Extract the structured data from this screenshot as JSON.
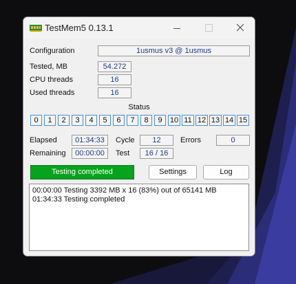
{
  "window": {
    "title": "TestMem5  0.13.1",
    "icons": {
      "app": "memory-module-icon",
      "minimize": "minimize-icon",
      "maximize": "maximize-icon",
      "close": "close-icon"
    }
  },
  "config": {
    "label": "Configuration",
    "value": "1usmus v3 @ 1usmus"
  },
  "tested": {
    "label": "Tested, MB",
    "value": "54.272"
  },
  "cpu_threads": {
    "label": "CPU threads",
    "value": "16"
  },
  "used_threads": {
    "label": "Used threads",
    "value": "16"
  },
  "status": {
    "title": "Status",
    "threads": [
      "0",
      "1",
      "2",
      "3",
      "4",
      "5",
      "6",
      "7",
      "8",
      "9",
      "10",
      "11",
      "12",
      "13",
      "14",
      "15"
    ]
  },
  "elapsed": {
    "label": "Elapsed",
    "value": "01:34:33"
  },
  "cycle": {
    "label": "Cycle",
    "value": "12"
  },
  "errors": {
    "label": "Errors",
    "value": "0"
  },
  "remaining": {
    "label": "Remaining",
    "value": "00:00:00"
  },
  "test": {
    "label": "Test",
    "value": "16 / 16"
  },
  "progress": {
    "text": "Testing completed",
    "percent": 100,
    "color": "#06a31c"
  },
  "buttons": {
    "settings": "Settings",
    "log": "Log"
  },
  "log": {
    "lines": [
      "00:00:00  Testing 3392 MB x 16 (83%) out of 65141 MB",
      "01:34:33  Testing completed"
    ]
  },
  "colors": {
    "accent_border": "#4a90d9",
    "value_text": "#1c3a8e",
    "window_bg": "#f0f0f0"
  }
}
